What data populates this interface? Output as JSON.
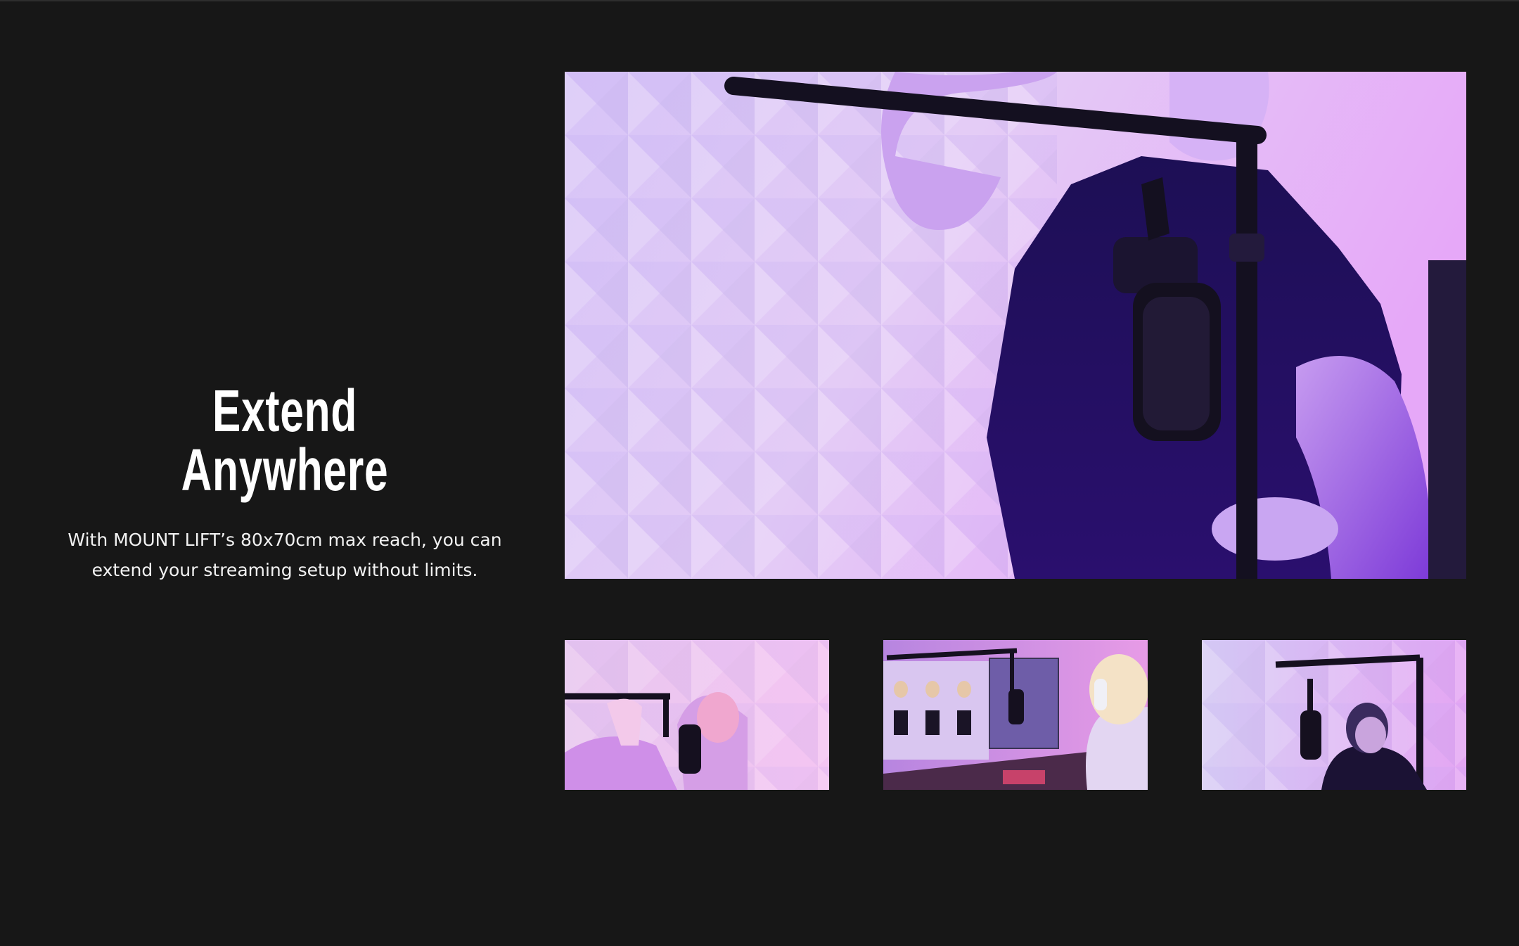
{
  "section": {
    "title": "Extend Anywhere",
    "description": "With MOUNT LIFT’s 80x70cm max reach, you can extend your streaming setup without limits."
  },
  "media": {
    "main": {
      "icon": "video-frame-mic-boom"
    },
    "thumbnails": [
      {
        "icon": "thumb-pink-hair-streamer"
      },
      {
        "icon": "thumb-headset-monitors"
      },
      {
        "icon": "thumb-boom-arm-man"
      }
    ]
  },
  "colors": {
    "background": "#171717",
    "accent": "#c98cff",
    "text": "#ffffff"
  }
}
